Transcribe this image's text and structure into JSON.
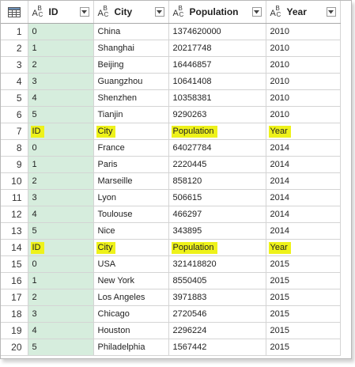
{
  "columns": [
    {
      "type_icon": "text-type-icon",
      "label": "ID"
    },
    {
      "type_icon": "text-type-icon",
      "label": "City"
    },
    {
      "type_icon": "text-type-icon",
      "label": "Population"
    },
    {
      "type_icon": "text-type-icon",
      "label": "Year"
    }
  ],
  "type_glyph": {
    "a": "A",
    "b": "B",
    "c": "C"
  },
  "highlight_color": "#eef21a",
  "id_column_color": "#d6eddd",
  "rows": [
    {
      "n": "1",
      "id": "0",
      "city": "China",
      "population": "1374620000",
      "year": "2010",
      "highlight": false
    },
    {
      "n": "2",
      "id": "1",
      "city": "Shanghai",
      "population": "20217748",
      "year": "2010",
      "highlight": false
    },
    {
      "n": "3",
      "id": "2",
      "city": "Beijing",
      "population": "16446857",
      "year": "2010",
      "highlight": false
    },
    {
      "n": "4",
      "id": "3",
      "city": "Guangzhou",
      "population": "10641408",
      "year": "2010",
      "highlight": false
    },
    {
      "n": "5",
      "id": "4",
      "city": "Shenzhen",
      "population": "10358381",
      "year": "2010",
      "highlight": false
    },
    {
      "n": "6",
      "id": "5",
      "city": "Tianjin",
      "population": "9290263",
      "year": "2010",
      "highlight": false
    },
    {
      "n": "7",
      "id": "ID",
      "city": "City",
      "population": "Population",
      "year": "Year",
      "highlight": true
    },
    {
      "n": "8",
      "id": "0",
      "city": "France",
      "population": "64027784",
      "year": "2014",
      "highlight": false
    },
    {
      "n": "9",
      "id": "1",
      "city": "Paris",
      "population": "2220445",
      "year": "2014",
      "highlight": false
    },
    {
      "n": "10",
      "id": "2",
      "city": "Marseille",
      "population": "858120",
      "year": "2014",
      "highlight": false
    },
    {
      "n": "11",
      "id": "3",
      "city": "Lyon",
      "population": "506615",
      "year": "2014",
      "highlight": false
    },
    {
      "n": "12",
      "id": "4",
      "city": "Toulouse",
      "population": "466297",
      "year": "2014",
      "highlight": false
    },
    {
      "n": "13",
      "id": "5",
      "city": "Nice",
      "population": "343895",
      "year": "2014",
      "highlight": false
    },
    {
      "n": "14",
      "id": "ID",
      "city": "City",
      "population": "Population",
      "year": "Year",
      "highlight": true
    },
    {
      "n": "15",
      "id": "0",
      "city": "USA",
      "population": "321418820",
      "year": "2015",
      "highlight": false
    },
    {
      "n": "16",
      "id": "1",
      "city": "New York",
      "population": "8550405",
      "year": "2015",
      "highlight": false
    },
    {
      "n": "17",
      "id": "2",
      "city": "Los Angeles",
      "population": "3971883",
      "year": "2015",
      "highlight": false
    },
    {
      "n": "18",
      "id": "3",
      "city": "Chicago",
      "population": "2720546",
      "year": "2015",
      "highlight": false
    },
    {
      "n": "19",
      "id": "4",
      "city": "Houston",
      "population": "2296224",
      "year": "2015",
      "highlight": false
    },
    {
      "n": "20",
      "id": "5",
      "city": "Philadelphia",
      "population": "1567442",
      "year": "2015",
      "highlight": false
    }
  ]
}
